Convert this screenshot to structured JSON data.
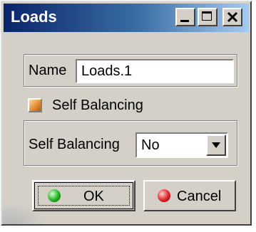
{
  "window": {
    "title": "Loads",
    "controls": {
      "minimize": "minimize-icon",
      "maximize": "maximize-icon",
      "close": "close-icon"
    }
  },
  "name_field": {
    "label": "Name",
    "value": "Loads.1"
  },
  "self_balancing_check": {
    "label": "Self Balancing",
    "checked": true
  },
  "self_balancing_select": {
    "label": "Self Balancing",
    "value": "No"
  },
  "buttons": {
    "ok": "OK",
    "cancel": "Cancel"
  },
  "colors": {
    "title_start": "#0a246a",
    "title_end": "#a6caf0",
    "dialog_bg": "#d4d0c8",
    "ok_dot": "#22b020",
    "cancel_dot": "#e02020"
  }
}
